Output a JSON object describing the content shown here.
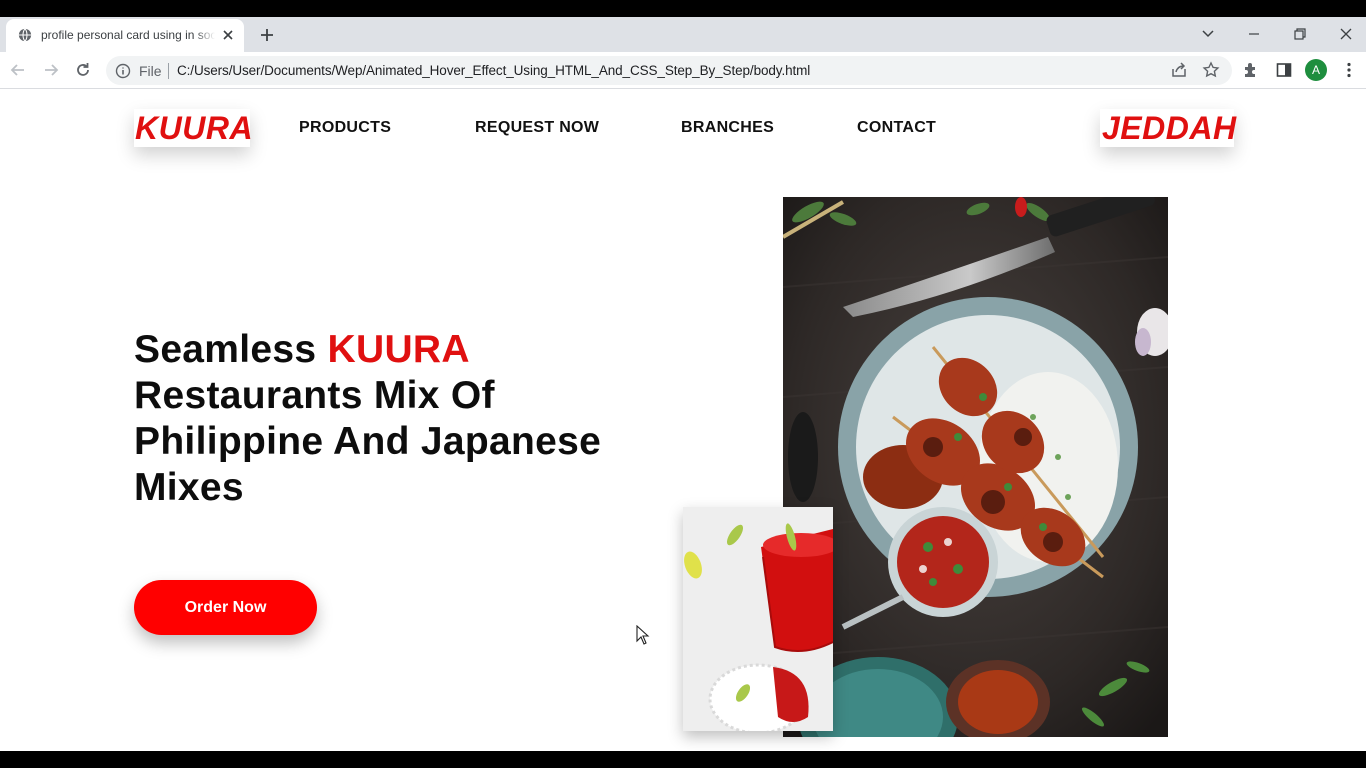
{
  "browser": {
    "tab_title": "profile personal card using in soc",
    "omnibox_scheme": "File",
    "url": "C:/Users/User/Documents/Wep/Animated_Hover_Effect_Using_HTML_And_CSS_Step_By_Step/body.html",
    "profile_initial": "A",
    "icons": [
      "globe-icon",
      "close-icon",
      "plus-icon",
      "chevron-down-icon",
      "minimize-icon",
      "restore-icon",
      "close-window-icon",
      "back-arrow-icon",
      "forward-arrow-icon",
      "reload-icon",
      "info-icon",
      "share-icon",
      "star-icon",
      "puzzle-icon",
      "side-panel-icon",
      "more-icon"
    ]
  },
  "header": {
    "logo_left": "KUURA",
    "logo_right": "JEDDAH",
    "nav": [
      "PRODUCTS",
      "REQUEST NOW",
      "BRANCHES",
      "CONTACT"
    ]
  },
  "hero": {
    "title_prefix": "Seamless ",
    "title_accent": "KUURA",
    "title_rest": " Restaurants Mix Of Philippine And Japanese Mixes",
    "button_label": "Order Now"
  },
  "colors": {
    "accent": "#e01010",
    "button": "#ff0000",
    "text": "#0d0d0d"
  }
}
